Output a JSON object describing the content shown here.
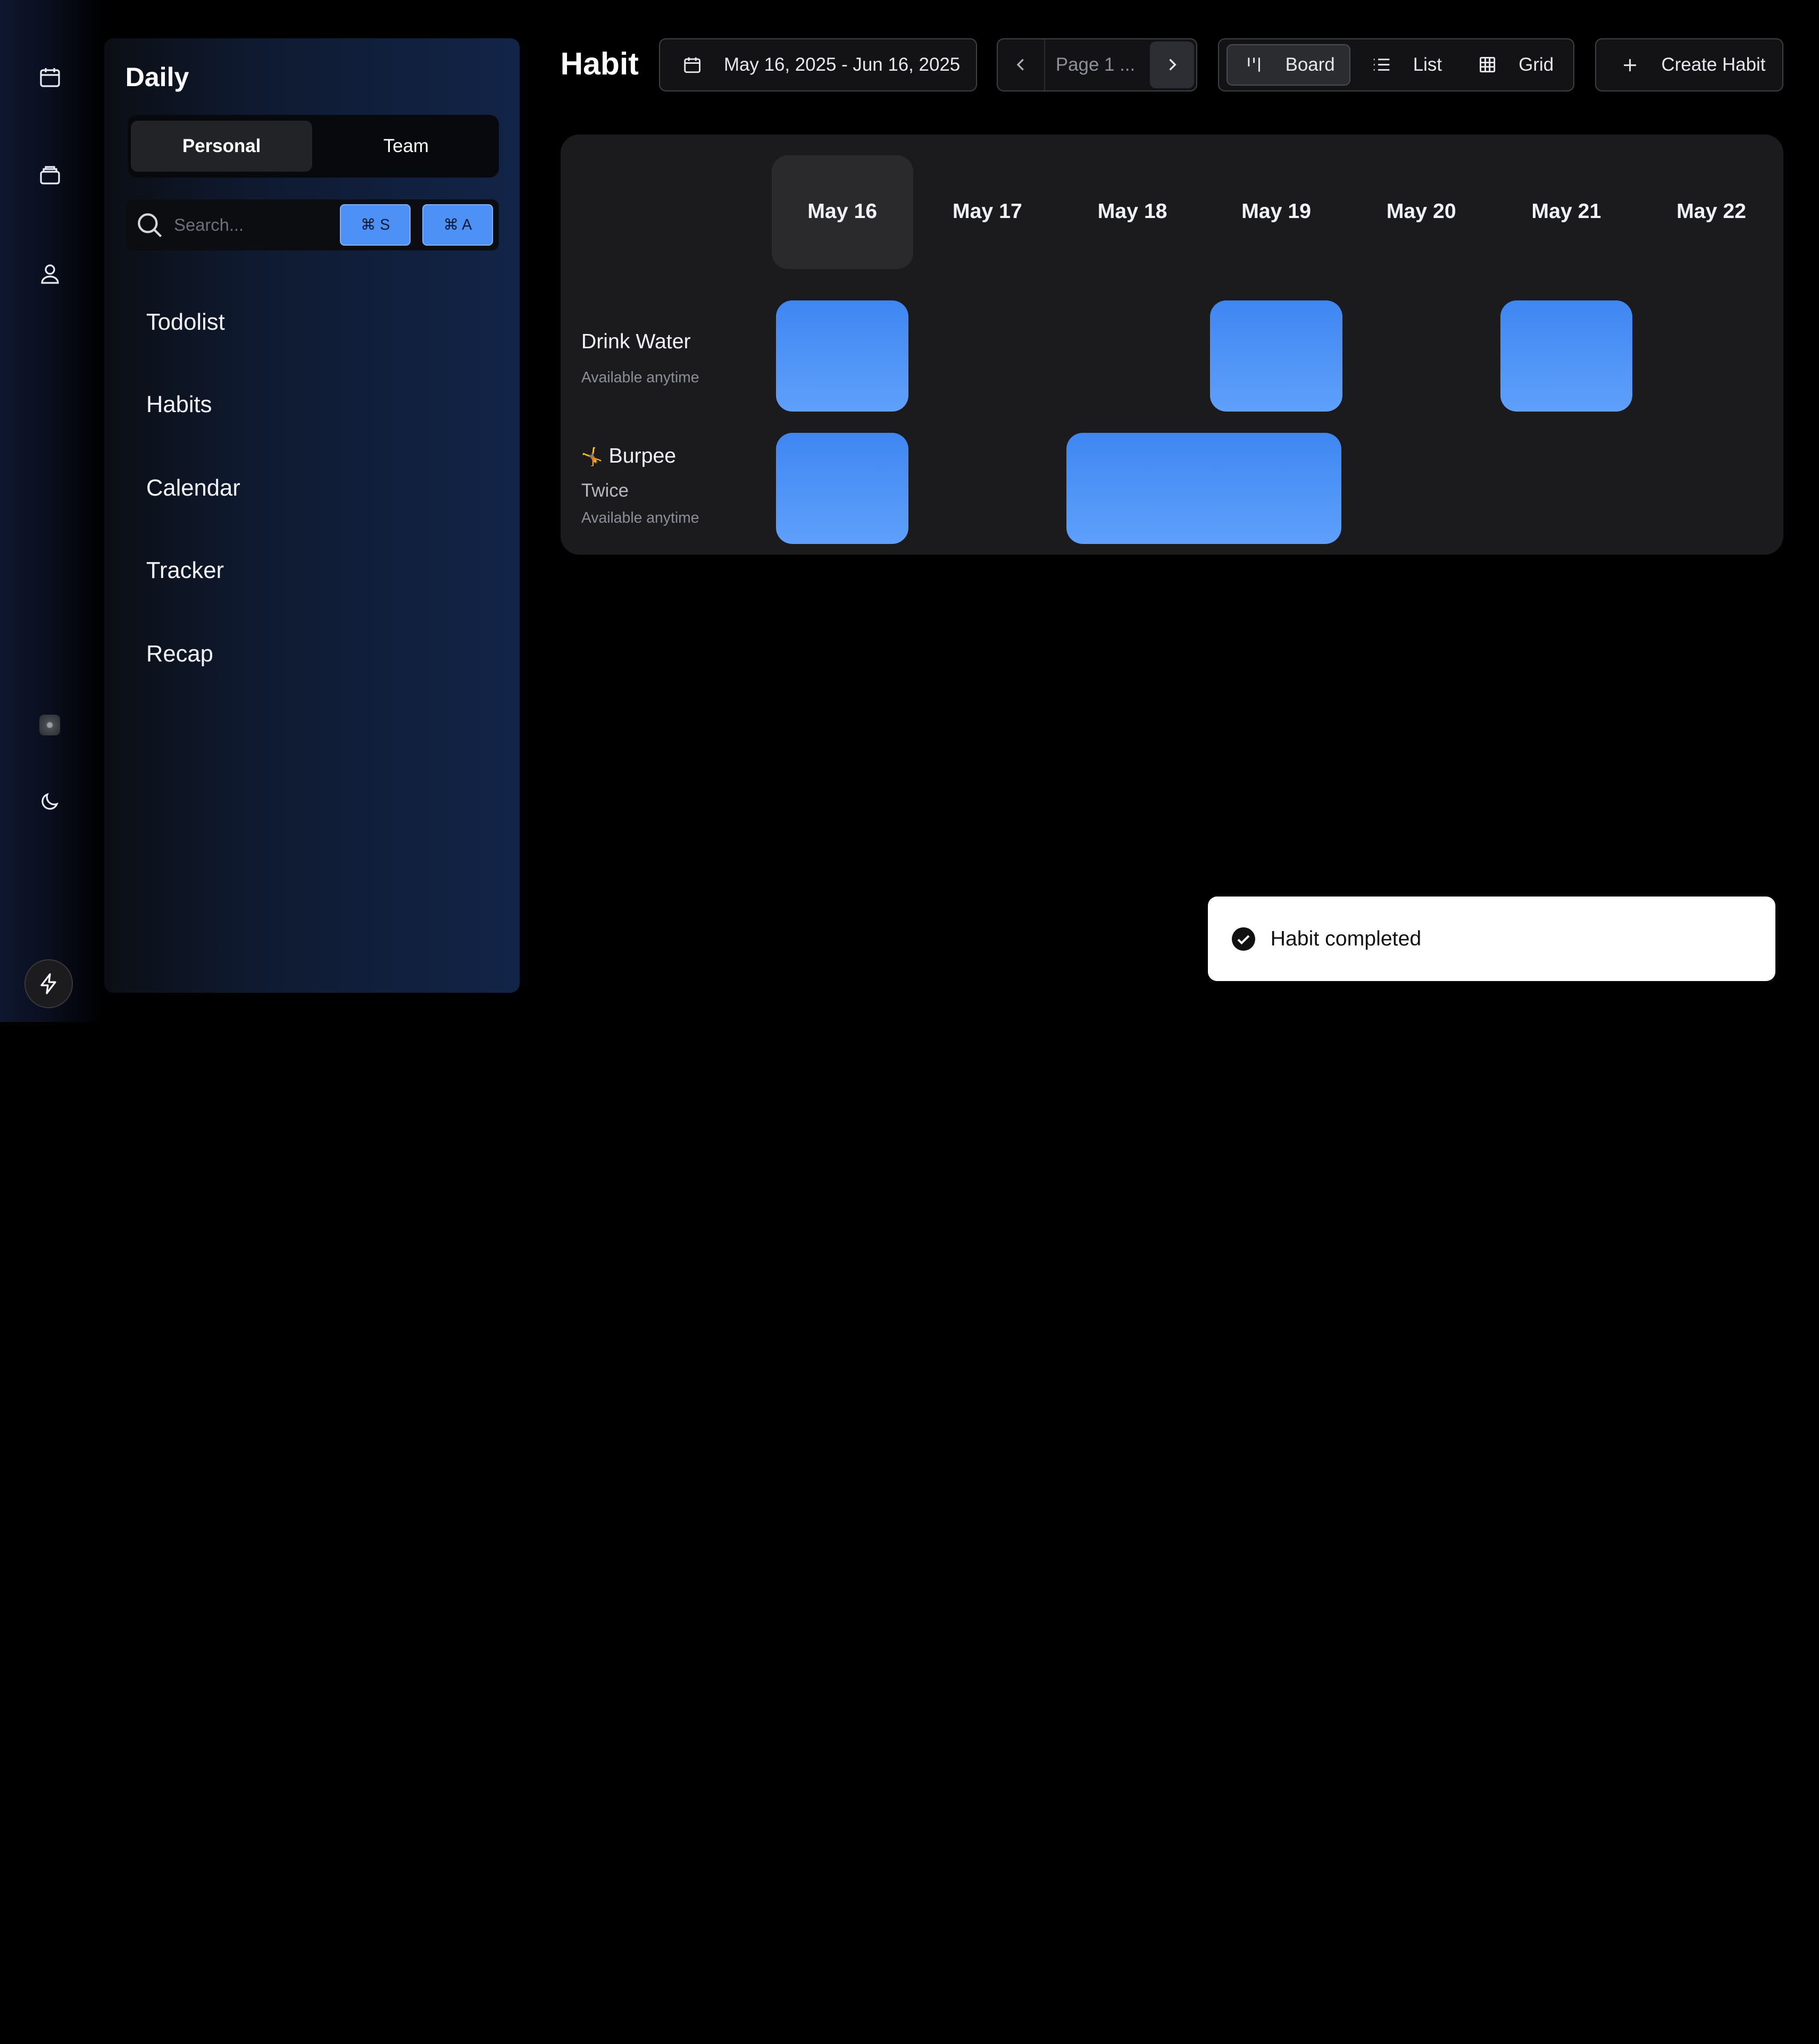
{
  "sidebar": {
    "title": "Daily",
    "tabs": [
      "Personal",
      "Team"
    ],
    "search": {
      "placeholder": "Search...",
      "shortcuts": [
        "⌘ S",
        "⌘ A"
      ]
    },
    "nav": [
      "Todolist",
      "Habits",
      "Calendar",
      "Tracker",
      "Recap"
    ]
  },
  "header": {
    "title": "Habit",
    "date_range": "May 16, 2025 - Jun 16, 2025",
    "page_label": "Page 1 ...",
    "views": [
      "Board",
      "List",
      "Grid"
    ],
    "active_view": "Board",
    "create_label": "Create Habit"
  },
  "board": {
    "days": [
      "May 16",
      "May 17",
      "May 18",
      "May 19",
      "May 20",
      "May 21",
      "May 22"
    ],
    "selected_day": "May 16",
    "habits": [
      {
        "name": "Drink Water",
        "availability": "Available anytime",
        "completed_days": [
          "May 16",
          "May 19",
          "May 21"
        ]
      },
      {
        "emoji": "🤸",
        "name": "Burpee",
        "frequency": "Twice",
        "availability": "Available anytime",
        "completed_days": [
          "May 16",
          "May 18",
          "May 19"
        ]
      }
    ]
  },
  "toast": {
    "message": "Habit completed"
  },
  "colors": {
    "accent": "#4d90f6",
    "cell_top": "#3f86f2",
    "cell_bottom": "#5ea0fa",
    "sidebar": "#122448"
  }
}
